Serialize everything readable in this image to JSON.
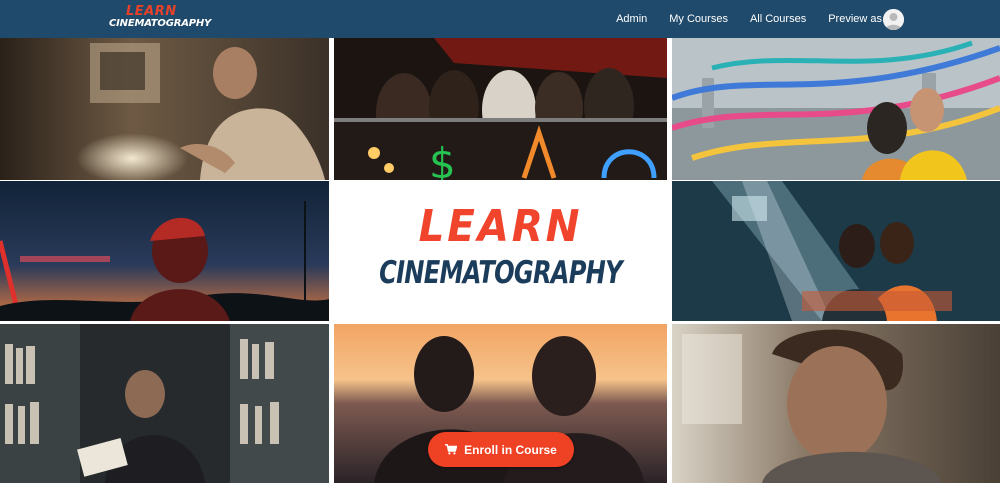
{
  "header": {
    "brand_line1": "LEARN",
    "brand_line2": "CINEMATOGRAPHY",
    "nav": [
      {
        "label": "Admin"
      },
      {
        "label": "My Courses"
      },
      {
        "label": "All Courses"
      },
      {
        "label": "Preview as"
      }
    ]
  },
  "hero": {
    "title_line1": "LEARN",
    "title_line2": "CINEMATOGRAPHY",
    "enroll_label": "Enroll in Course",
    "enroll_icon": "shopping-cart-icon"
  },
  "colors": {
    "header_bg": "#1f4a6b",
    "accent": "#ef4123",
    "brand_dark": "#1b3d5b"
  }
}
